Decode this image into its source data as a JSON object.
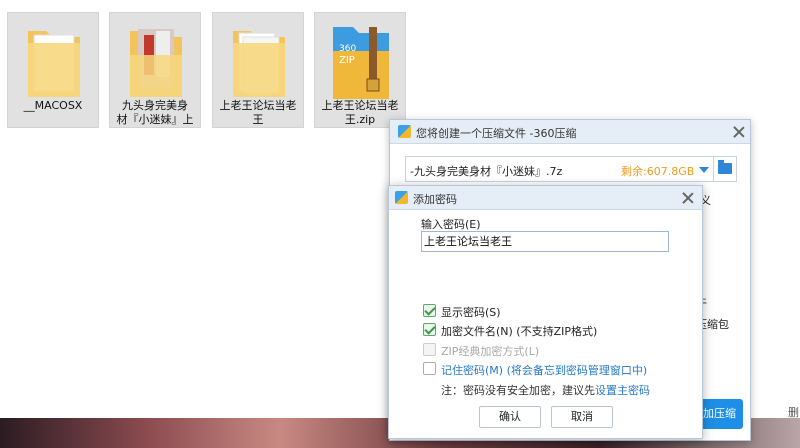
{
  "desktop": {
    "items": [
      {
        "label": "__MACOSX",
        "kind": "folder"
      },
      {
        "label": "九头身完美身\n材『小迷妹』上",
        "kind": "photo-folder"
      },
      {
        "label": "上老王论坛当老\n王",
        "kind": "folder"
      },
      {
        "label": "上老王论坛当老\n王.zip",
        "kind": "zip"
      }
    ],
    "zip_icon_text": "360\nZIP",
    "corner_glyph": "删"
  },
  "compress_dialog": {
    "title": "您将创建一个压缩文件 -360压缩",
    "filename": "-九头身完美身材『小迷妹』.7z",
    "free_space": "剩余:607.8GB",
    "frag_1": "义",
    "frag_2": "牛",
    "frag_3": "压缩包",
    "compress_button": "加压缩"
  },
  "password_dialog": {
    "title": "添加密码",
    "input_label": "输入密码(E)",
    "password_value": "上老王论坛当老王",
    "options": [
      {
        "label": "显示密码(S)",
        "checked": true,
        "disabled": false
      },
      {
        "label": "加密文件名(N) (不支持ZIP格式)",
        "checked": true,
        "disabled": false
      },
      {
        "label": "ZIP经典加密方式(L)",
        "checked": false,
        "disabled": true
      },
      {
        "label": "记住密码(M) (将会备忘到密码管理窗口中)",
        "checked": false,
        "disabled": false
      }
    ],
    "note_text": "注：密码没有安全加密，建议先",
    "note_link": "设置主密码",
    "ok_button": "确认",
    "cancel_button": "取消"
  },
  "colors": {
    "accent": "#1e8fe6",
    "free_space": "#f39a1e",
    "link": "#2679c8",
    "check": "#3e9a48"
  }
}
